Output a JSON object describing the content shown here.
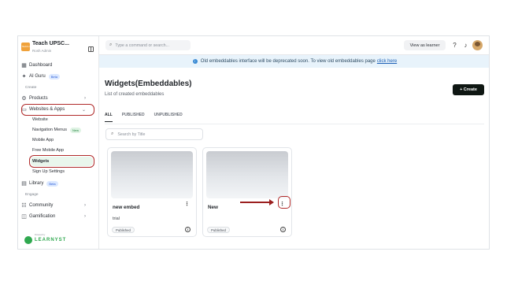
{
  "brand": {
    "title": "Teach UPSC...",
    "subtitle": "Rosh Admin",
    "logo_text": "TEACH UPSC"
  },
  "sidebar": {
    "dashboard": "Dashboard",
    "ai_guru": "AI Guru",
    "ai_guru_badge": "Beta",
    "section_create": "Create",
    "products": "Products",
    "websites_apps": "Websites & Apps",
    "sub_items": [
      "Website",
      "Navigation Menus",
      "Mobile App",
      "Free Mobile App",
      "Widgets",
      "Sign Up Settings"
    ],
    "nav_menus_badge": "New",
    "library": "Library",
    "library_badge": "Beta",
    "section_engage": "Engage",
    "community": "Community",
    "gamification": "Gamification",
    "footer_pre": "Powered by",
    "footer_brand": "LEARNYST"
  },
  "topbar": {
    "search_placeholder": "Type a command or search...",
    "view_as_learner": "View as learner"
  },
  "banner": {
    "text": "Old embeddables interface will be deprecated soon. To view old embeddables page",
    "link": "click here"
  },
  "page": {
    "title": "Widgets(Embeddables)",
    "subtitle": "List of created embeddables",
    "create_label": "+ Create",
    "tabs": [
      "ALL",
      "PUBLISHED",
      "UNPUBLISHED"
    ],
    "search_placeholder": "Search by Title"
  },
  "cards": [
    {
      "title": "new embed",
      "description": "trial",
      "status": "Published"
    },
    {
      "title": "New",
      "description": "",
      "status": "Published"
    }
  ],
  "colors": {
    "accent_green": "#2fa84f",
    "highlight_red": "#b02a2a",
    "banner_bg": "#e8f3fb"
  }
}
